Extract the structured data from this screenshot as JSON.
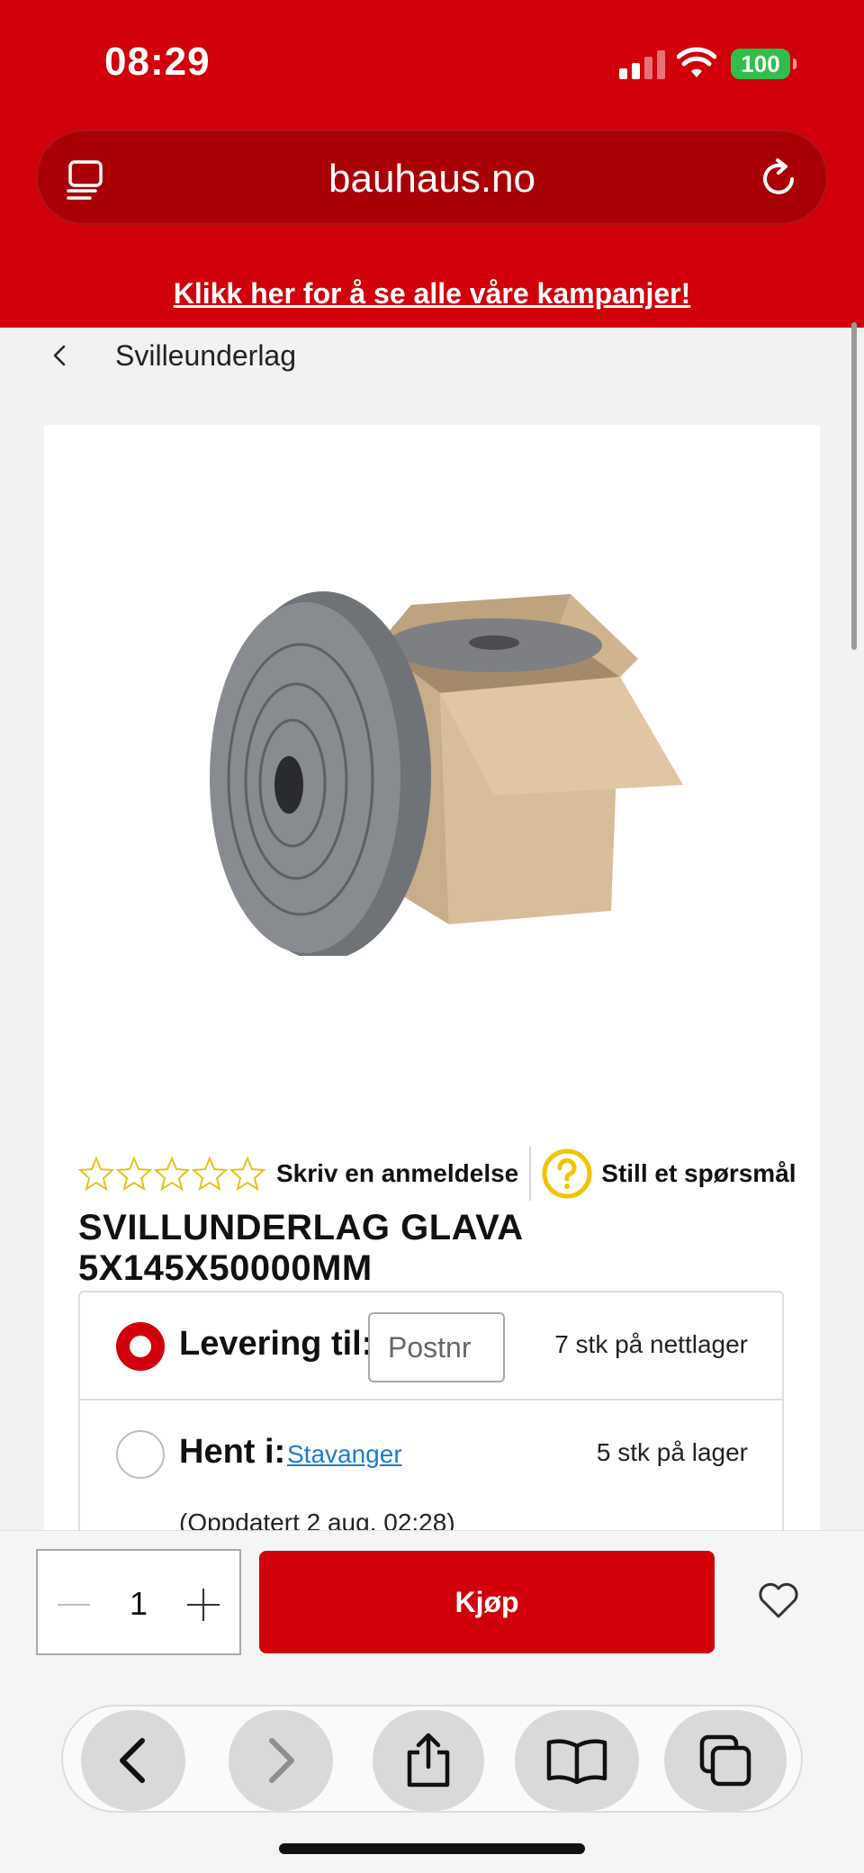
{
  "status_bar": {
    "time": "08:29",
    "battery": "100",
    "battery_color": "#2fbf4a"
  },
  "browser": {
    "url": "bauhaus.no",
    "reader_icon": "reader-mode-icon",
    "reload_icon": "reload-icon"
  },
  "promo": {
    "text": "Klikk her for å se alle våre kampanjer!"
  },
  "brand_color": "#d1000a",
  "breadcrumb": {
    "label": "Svilleunderlag"
  },
  "product": {
    "review_link": "Skriv en anmeldelse",
    "question_link": "Still et spørsmål",
    "rating": 0,
    "max_rating": 5,
    "title": "SVILLUNDERLAG GLAVA 5X145X50000MM"
  },
  "delivery": {
    "delivery_label": "Levering til:",
    "postnr_placeholder": "Postnr",
    "online_stock": "7 stk på nettlager",
    "pickup_label": "Hent i:",
    "store": "Stavanger",
    "store_stock": "5 stk på lager",
    "updated": "(Oppdatert 2 aug. 02:28)"
  },
  "purchase": {
    "quantity": "1",
    "buy_label": "Kjøp"
  },
  "toolbar": {
    "icons": [
      "back-icon",
      "forward-icon",
      "share-icon",
      "bookmarks-icon",
      "tabs-icon"
    ]
  }
}
